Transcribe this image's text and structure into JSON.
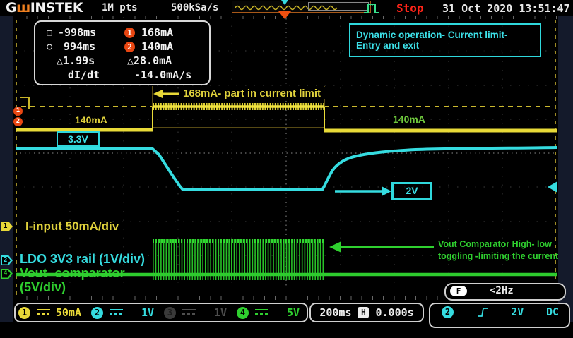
{
  "header": {
    "logo_g": "G",
    "logo_sha": "ш",
    "logo_rest": "INSTEK",
    "memory_depth": "1M pts",
    "sample_rate": "500kSa/s",
    "run_status": "Stop",
    "datetime": "31 Oct 2020 13:51:47"
  },
  "cursor_panel": {
    "row1_symbol": "□",
    "row1_time": "-998ms",
    "row1_marker": "1",
    "row1_value": "168mA",
    "row2_symbol": "○",
    "row2_time": "994ms",
    "row2_marker": "2",
    "row2_value": "140mA",
    "row3_delta_time": "△1.99s",
    "row3_delta_value": "△28.0mA",
    "row4_label": "dI/dt",
    "row4_value": "-14.0mA/s"
  },
  "annotations": {
    "title": "Dynamic operation- Current limit- Entry and exit",
    "current_limit_span": "168mA- part in current limit",
    "left_current": "140mA",
    "right_current": "140mA",
    "rail_nominal": "3.3V",
    "rail_drop": "2V",
    "comparator_note_line1": "Vout Comparator High- low",
    "comparator_note_line2": "toggling -limiting the current"
  },
  "channel_labels": {
    "ch1": "I-input 50mA/div",
    "ch2": "LDO 3V3 rail (1V/div)",
    "ch4_line1": "Vout- comparator",
    "ch4_line2": "(5V/div)"
  },
  "markers": {
    "cursor1_badge": "1",
    "cursor2_badge": "2",
    "ch1_tag": "1",
    "ch2_tag": "2",
    "ch4_tag": "4"
  },
  "status_bar": {
    "channels": [
      {
        "num": "1",
        "scale": "50mA"
      },
      {
        "num": "2",
        "scale": "1V"
      },
      {
        "num": "3",
        "scale": "1V"
      },
      {
        "num": "4",
        "scale": "5V"
      }
    ],
    "timebase": "200ms",
    "h_icon": "H",
    "h_offset": "0.000s",
    "trigger_source": "2",
    "trigger_level": "2V",
    "trigger_coupling": "DC",
    "freq_icon": "F",
    "freq_readout": "<2Hz"
  },
  "colors": {
    "ch1_yellow": "#e8d838",
    "ch2_cyan": "#35dce0",
    "ch4_green": "#2fd02f",
    "stop_red": "#ff2418",
    "cursor_marker_orange": "#e84612"
  }
}
